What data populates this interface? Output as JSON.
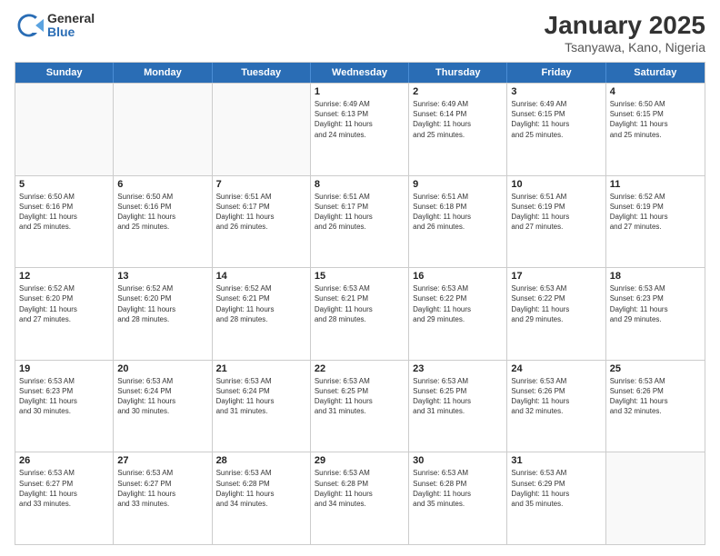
{
  "logo": {
    "general": "General",
    "blue": "Blue"
  },
  "header": {
    "title": "January 2025",
    "subtitle": "Tsanyawa, Kano, Nigeria"
  },
  "weekdays": [
    "Sunday",
    "Monday",
    "Tuesday",
    "Wednesday",
    "Thursday",
    "Friday",
    "Saturday"
  ],
  "rows": [
    [
      {
        "day": "",
        "info": ""
      },
      {
        "day": "",
        "info": ""
      },
      {
        "day": "",
        "info": ""
      },
      {
        "day": "1",
        "info": "Sunrise: 6:49 AM\nSunset: 6:13 PM\nDaylight: 11 hours\nand 24 minutes."
      },
      {
        "day": "2",
        "info": "Sunrise: 6:49 AM\nSunset: 6:14 PM\nDaylight: 11 hours\nand 25 minutes."
      },
      {
        "day": "3",
        "info": "Sunrise: 6:49 AM\nSunset: 6:15 PM\nDaylight: 11 hours\nand 25 minutes."
      },
      {
        "day": "4",
        "info": "Sunrise: 6:50 AM\nSunset: 6:15 PM\nDaylight: 11 hours\nand 25 minutes."
      }
    ],
    [
      {
        "day": "5",
        "info": "Sunrise: 6:50 AM\nSunset: 6:16 PM\nDaylight: 11 hours\nand 25 minutes."
      },
      {
        "day": "6",
        "info": "Sunrise: 6:50 AM\nSunset: 6:16 PM\nDaylight: 11 hours\nand 25 minutes."
      },
      {
        "day": "7",
        "info": "Sunrise: 6:51 AM\nSunset: 6:17 PM\nDaylight: 11 hours\nand 26 minutes."
      },
      {
        "day": "8",
        "info": "Sunrise: 6:51 AM\nSunset: 6:17 PM\nDaylight: 11 hours\nand 26 minutes."
      },
      {
        "day": "9",
        "info": "Sunrise: 6:51 AM\nSunset: 6:18 PM\nDaylight: 11 hours\nand 26 minutes."
      },
      {
        "day": "10",
        "info": "Sunrise: 6:51 AM\nSunset: 6:19 PM\nDaylight: 11 hours\nand 27 minutes."
      },
      {
        "day": "11",
        "info": "Sunrise: 6:52 AM\nSunset: 6:19 PM\nDaylight: 11 hours\nand 27 minutes."
      }
    ],
    [
      {
        "day": "12",
        "info": "Sunrise: 6:52 AM\nSunset: 6:20 PM\nDaylight: 11 hours\nand 27 minutes."
      },
      {
        "day": "13",
        "info": "Sunrise: 6:52 AM\nSunset: 6:20 PM\nDaylight: 11 hours\nand 28 minutes."
      },
      {
        "day": "14",
        "info": "Sunrise: 6:52 AM\nSunset: 6:21 PM\nDaylight: 11 hours\nand 28 minutes."
      },
      {
        "day": "15",
        "info": "Sunrise: 6:53 AM\nSunset: 6:21 PM\nDaylight: 11 hours\nand 28 minutes."
      },
      {
        "day": "16",
        "info": "Sunrise: 6:53 AM\nSunset: 6:22 PM\nDaylight: 11 hours\nand 29 minutes."
      },
      {
        "day": "17",
        "info": "Sunrise: 6:53 AM\nSunset: 6:22 PM\nDaylight: 11 hours\nand 29 minutes."
      },
      {
        "day": "18",
        "info": "Sunrise: 6:53 AM\nSunset: 6:23 PM\nDaylight: 11 hours\nand 29 minutes."
      }
    ],
    [
      {
        "day": "19",
        "info": "Sunrise: 6:53 AM\nSunset: 6:23 PM\nDaylight: 11 hours\nand 30 minutes."
      },
      {
        "day": "20",
        "info": "Sunrise: 6:53 AM\nSunset: 6:24 PM\nDaylight: 11 hours\nand 30 minutes."
      },
      {
        "day": "21",
        "info": "Sunrise: 6:53 AM\nSunset: 6:24 PM\nDaylight: 11 hours\nand 31 minutes."
      },
      {
        "day": "22",
        "info": "Sunrise: 6:53 AM\nSunset: 6:25 PM\nDaylight: 11 hours\nand 31 minutes."
      },
      {
        "day": "23",
        "info": "Sunrise: 6:53 AM\nSunset: 6:25 PM\nDaylight: 11 hours\nand 31 minutes."
      },
      {
        "day": "24",
        "info": "Sunrise: 6:53 AM\nSunset: 6:26 PM\nDaylight: 11 hours\nand 32 minutes."
      },
      {
        "day": "25",
        "info": "Sunrise: 6:53 AM\nSunset: 6:26 PM\nDaylight: 11 hours\nand 32 minutes."
      }
    ],
    [
      {
        "day": "26",
        "info": "Sunrise: 6:53 AM\nSunset: 6:27 PM\nDaylight: 11 hours\nand 33 minutes."
      },
      {
        "day": "27",
        "info": "Sunrise: 6:53 AM\nSunset: 6:27 PM\nDaylight: 11 hours\nand 33 minutes."
      },
      {
        "day": "28",
        "info": "Sunrise: 6:53 AM\nSunset: 6:28 PM\nDaylight: 11 hours\nand 34 minutes."
      },
      {
        "day": "29",
        "info": "Sunrise: 6:53 AM\nSunset: 6:28 PM\nDaylight: 11 hours\nand 34 minutes."
      },
      {
        "day": "30",
        "info": "Sunrise: 6:53 AM\nSunset: 6:28 PM\nDaylight: 11 hours\nand 35 minutes."
      },
      {
        "day": "31",
        "info": "Sunrise: 6:53 AM\nSunset: 6:29 PM\nDaylight: 11 hours\nand 35 minutes."
      },
      {
        "day": "",
        "info": ""
      }
    ]
  ]
}
